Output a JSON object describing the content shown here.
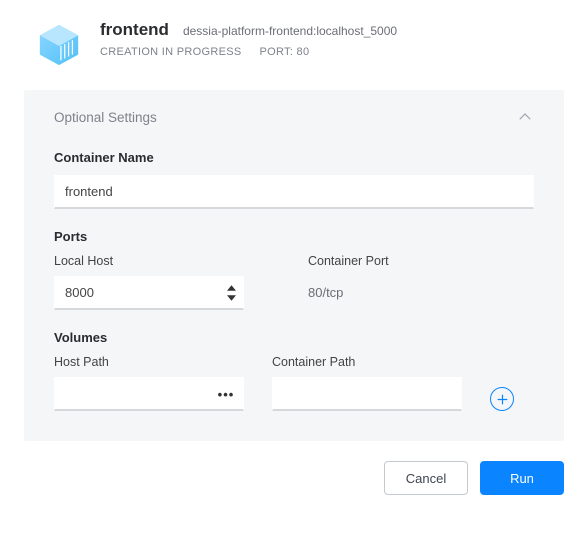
{
  "header": {
    "title": "frontend",
    "image_ref": "dessia-platform-frontend:localhost_5000",
    "status": "CREATION IN PROGRESS",
    "port_label": "PORT: 80"
  },
  "panel": {
    "title": "Optional Settings",
    "container_name": {
      "label": "Container Name",
      "value": "frontend"
    },
    "ports": {
      "label": "Ports",
      "local_host_label": "Local Host",
      "local_host_value": "8000",
      "container_port_label": "Container Port",
      "container_port_value": "80/tcp"
    },
    "volumes": {
      "label": "Volumes",
      "host_path_label": "Host Path",
      "host_path_value": "",
      "container_path_label": "Container Path",
      "container_path_value": ""
    }
  },
  "footer": {
    "cancel": "Cancel",
    "run": "Run"
  },
  "icons": {
    "browse": "•••"
  }
}
